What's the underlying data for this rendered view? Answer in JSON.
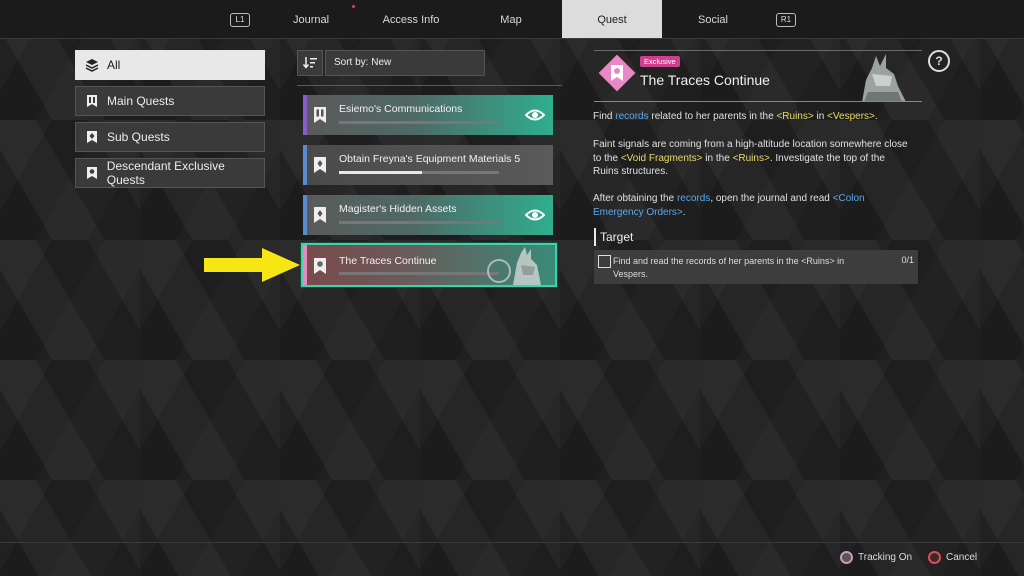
{
  "nav": {
    "left_button": "L1",
    "right_button": "R1",
    "tabs": [
      {
        "label": "Journal"
      },
      {
        "label": "Access Info"
      },
      {
        "label": "Map"
      },
      {
        "label": "Quest"
      },
      {
        "label": "Social"
      }
    ],
    "active_tab": "Quest"
  },
  "categories": [
    {
      "label": "All",
      "icon": "layers-icon",
      "active": true
    },
    {
      "label": "Main Quests",
      "icon": "main-quest-icon",
      "active": false
    },
    {
      "label": "Sub Quests",
      "icon": "sub-quest-icon",
      "active": false
    },
    {
      "label": "Descendant Exclusive Quests",
      "icon": "exclusive-quest-icon",
      "active": false
    }
  ],
  "sort": {
    "label": "Sort by: New",
    "icon": "sort-icon"
  },
  "quests": [
    {
      "title": "Esiemo's Communications",
      "stripe_color": "#8a5ad0",
      "progress": 0.0,
      "tracked": true
    },
    {
      "title": "Obtain Freyna's Equipment Materials 5",
      "stripe_color": "#5a8ad0",
      "progress": 0.52,
      "tracked": false
    },
    {
      "title": "Magister's Hidden Assets",
      "stripe_color": "#5a8ad0",
      "progress": 0.0,
      "tracked": true
    },
    {
      "title": "The Traces Continue",
      "stripe_color": "#e889c6",
      "progress": 0.0,
      "tracked": false,
      "selected": true
    }
  ],
  "detail": {
    "badge": "Exclusive",
    "title": "The Traces Continue",
    "help": "?",
    "p1": {
      "a": "Find ",
      "b": "records",
      "c": " related to her parents in the ",
      "d": "<Ruins>",
      "e": " in ",
      "f": "<Vespers>",
      "g": "."
    },
    "p2": {
      "a": "Faint signals are coming from a high-altitude location somewhere close to the ",
      "b": "<Void Fragments>",
      "c": " in the ",
      "d": "<Ruins>",
      "e": ". Investigate the top of the Ruins structures."
    },
    "p3": {
      "a": "After obtaining the ",
      "b": "records",
      "c": ", open the journal and read ",
      "d": "<Colon Emergency Orders>",
      "e": "."
    },
    "target_heading": "Target",
    "target": {
      "text": "Find and read the records of her parents in the <Ruins> in Vespers.",
      "count": "0/1"
    }
  },
  "footer": {
    "tracking_label": "Tracking On",
    "cancel_label": "Cancel"
  },
  "colors": {
    "accent_teal": "#3fd3a8",
    "exclusive_pink": "#cf3f8d",
    "highlight_arrow": "#f5e614"
  }
}
